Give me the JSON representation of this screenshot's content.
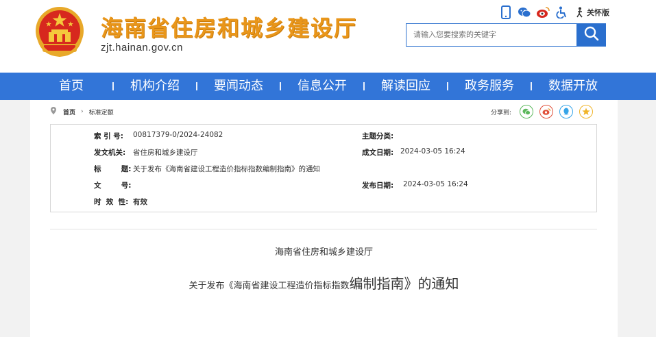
{
  "header": {
    "site_title": "海南省住房和城乡建设厅",
    "site_url": "zjt.hainan.gov.cn",
    "care_label": "关怀版",
    "search": {
      "placeholder": "请输入您要搜索的关键字",
      "value": ""
    },
    "title_color": "#e9961a",
    "top_icons": [
      "mobile-icon",
      "wechat-icon",
      "weibo-icon",
      "accessibility-icon",
      "care-mode-icon"
    ]
  },
  "nav": {
    "color": "#3275d8",
    "items": [
      "首页",
      "机构介绍",
      "要闻动态",
      "信息公开",
      "解读回应",
      "政务服务",
      "数据开放"
    ]
  },
  "breadcrumb": {
    "home": "首页",
    "current": "标准定额"
  },
  "share": {
    "label": "分享到:",
    "icons": [
      "wechat-share-icon",
      "weibo-share-icon",
      "qq-share-icon",
      "qzone-share-icon"
    ]
  },
  "info": {
    "index_label": "索  引  号:",
    "index_value": "00817379-0/2024-24082",
    "topic_label": "主题分类:",
    "topic_value": "",
    "issuer_label": "发文机关:",
    "issuer_value": "省住房和城乡建设厅",
    "created_label": "成文日期:",
    "created_value": "2024-03-05 16:24",
    "title_label": "标        题:",
    "title_value": "关于发布《海南省建设工程造价指标指数编制指南》的通知",
    "docno_label": "文        号:",
    "docno_value": "",
    "published_label": "发布日期:",
    "published_value": "2024-03-05 16:24",
    "validity_label": "时  效  性:",
    "validity_value": "有效"
  },
  "document": {
    "org": "海南省住房和城乡建设厅",
    "title_part1": "关于发布《海南省建设工程造价指标指数",
    "title_part2": "编制指南》的通知"
  }
}
